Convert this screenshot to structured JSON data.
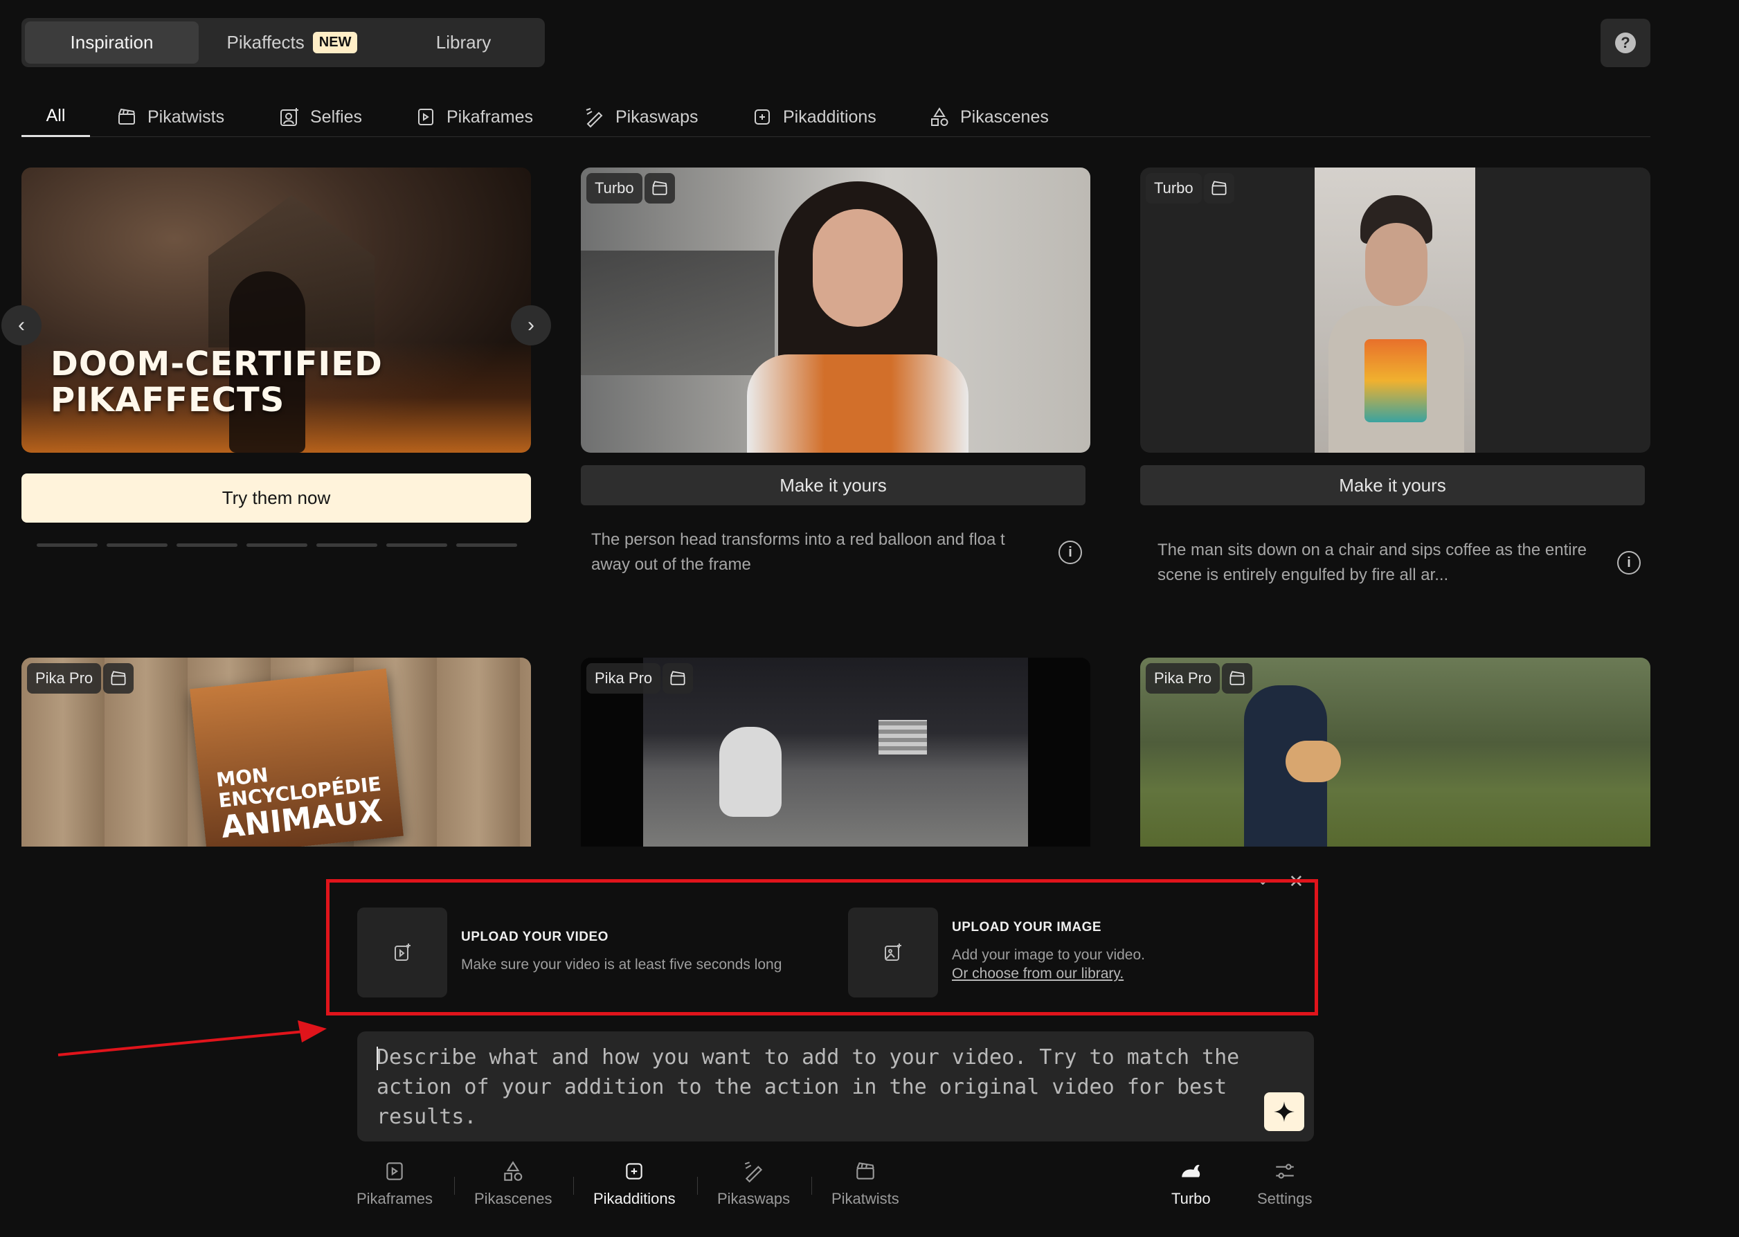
{
  "top_tabs": {
    "inspiration": "Inspiration",
    "pikaffects": "Pikaffects",
    "new_badge": "NEW",
    "library": "Library"
  },
  "help": {
    "icon": "question-circle-icon",
    "glyph": "?"
  },
  "categories": {
    "all": "All",
    "pikatwists": "Pikatwists",
    "selfies": "Selfies",
    "pikaframes": "Pikaframes",
    "pikaswaps": "Pikaswaps",
    "pikadditions": "Pikadditions",
    "pikascenes": "Pikascenes"
  },
  "promo": {
    "title_line1": "DOOM-CERTIFIED",
    "title_line2": "PIKAFFECTS",
    "cta": "Try them now",
    "prev_glyph": "‹",
    "next_glyph": "›"
  },
  "cards": [
    {
      "badge": "Turbo",
      "cta": "Make it yours",
      "description": "The person head transforms into a red balloon and floa t away out of the frame"
    },
    {
      "badge": "Turbo",
      "cta": "Make it yours",
      "description": "The man sits down on a chair and sips coffee as the entire scene is entirely engulfed by fire all ar..."
    },
    {
      "badge": "Pika Pro"
    },
    {
      "badge": "Pika Pro"
    },
    {
      "badge": "Pika Pro"
    }
  ],
  "book": {
    "line1": "MON",
    "line2": "ENCYCLOPÉDIE",
    "line3": "ANIMAUX"
  },
  "upload": {
    "video_title": "UPLOAD YOUR VIDEO",
    "video_sub": "Make sure your video is at least five seconds long",
    "image_title": "UPLOAD YOUR IMAGE",
    "image_sub": "Add your image to your video.",
    "image_link": "Or choose from our library."
  },
  "prompt": {
    "placeholder": "Describe what and how you want to add to your video. Try to match the action of your addition to the action in the original video for best results."
  },
  "toolbar": {
    "pikaframes": "Pikaframes",
    "pikascenes": "Pikascenes",
    "pikadditions": "Pikadditions",
    "pikaswaps": "Pikaswaps",
    "pikatwists": "Pikatwists",
    "turbo": "Turbo",
    "settings": "Settings"
  },
  "colors": {
    "accent_cream": "#fff3db",
    "highlight_red": "#e0141b",
    "background": "#0f0f0f"
  }
}
